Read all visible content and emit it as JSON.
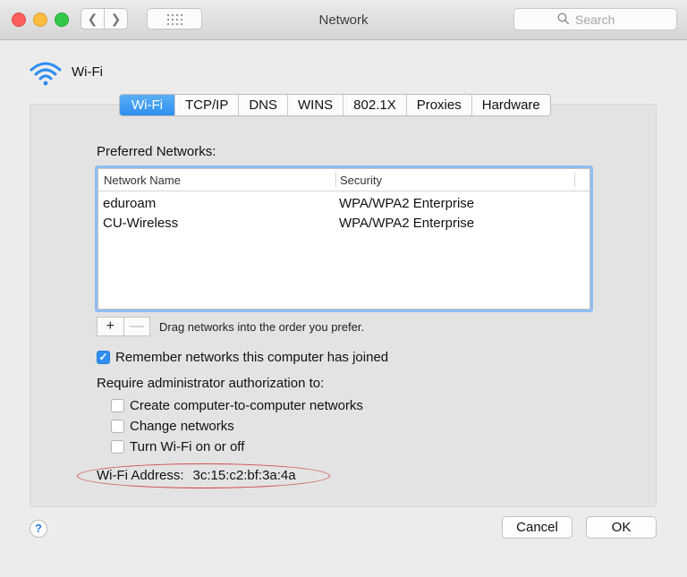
{
  "window": {
    "title": "Network"
  },
  "toolbar": {
    "search_placeholder": "Search"
  },
  "interface": {
    "name": "Wi-Fi"
  },
  "tabs": [
    {
      "label": "Wi-Fi",
      "active": true
    },
    {
      "label": "TCP/IP",
      "active": false
    },
    {
      "label": "DNS",
      "active": false
    },
    {
      "label": "WINS",
      "active": false
    },
    {
      "label": "802.1X",
      "active": false
    },
    {
      "label": "Proxies",
      "active": false
    },
    {
      "label": "Hardware",
      "active": false
    }
  ],
  "preferred": {
    "label": "Preferred Networks:",
    "columns": [
      "Network Name",
      "Security"
    ],
    "rows": [
      {
        "name": "eduroam",
        "security": "WPA/WPA2 Enterprise"
      },
      {
        "name": "CU-Wireless",
        "security": "WPA/WPA2 Enterprise"
      }
    ],
    "add_label": "+",
    "remove_label": "—",
    "hint": "Drag networks into the order you prefer."
  },
  "options": {
    "remember": {
      "label": "Remember networks this computer has joined",
      "checked": true
    },
    "require_label": "Require administrator authorization to:",
    "auth": [
      {
        "label": "Create computer-to-computer networks",
        "checked": false
      },
      {
        "label": "Change networks",
        "checked": false
      },
      {
        "label": "Turn Wi-Fi on or off",
        "checked": false
      }
    ]
  },
  "address": {
    "label": "Wi-Fi Address:",
    "value": "3c:15:c2:bf:3a:4a"
  },
  "buttons": {
    "help": "?",
    "cancel": "Cancel",
    "ok": "OK"
  },
  "colors": {
    "accent": "#2f8ef2",
    "annotation": "#d14d4d"
  }
}
